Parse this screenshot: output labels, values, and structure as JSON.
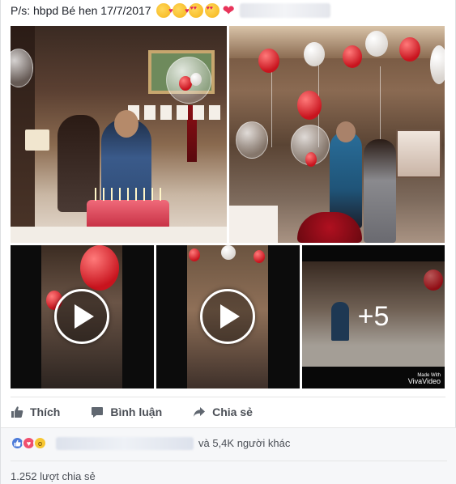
{
  "post": {
    "caption": "P/s: hbpd Bé hen 17/7/2017",
    "caption_emojis": [
      "kissing-heart-emoji",
      "kissing-heart-emoji",
      "heart-eyes-emoji",
      "heart-eyes-emoji",
      "red-heart-emoji"
    ],
    "more_count": "+5",
    "watermark_line1": "Made With",
    "watermark_line2": "VivaVideo"
  },
  "actions": {
    "like_label": "Thích",
    "comment_label": "Bình luận",
    "share_label": "Chia sẻ"
  },
  "reactions": {
    "types": [
      "like",
      "love",
      "wow"
    ],
    "others_text": "và 5,4K người khác",
    "shares_text": "1.252 lượt chia sẻ"
  },
  "colors": {
    "action_text": "#4b4f56",
    "like_blue": "#4c7bd9",
    "love_red": "#f0506e",
    "wow_yellow": "#f7c631"
  }
}
